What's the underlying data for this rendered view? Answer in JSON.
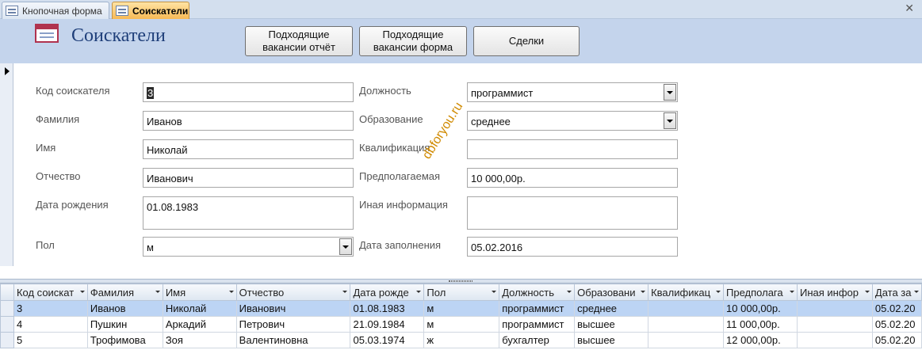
{
  "tabs": [
    {
      "label": "Кнопочная форма",
      "active": false
    },
    {
      "label": "Соискатели",
      "active": true
    }
  ],
  "form": {
    "title": "Соискатели",
    "buttons": {
      "report": "Подходящие\nвакансии отчёт",
      "form": "Подходящие\nвакансии форма",
      "deals": "Сделки"
    }
  },
  "fields": {
    "id": {
      "label": "Код соискателя",
      "value": "3"
    },
    "surname": {
      "label": "Фамилия",
      "value": "Иванов"
    },
    "name": {
      "label": "Имя",
      "value": "Николай"
    },
    "patronymic": {
      "label": "Отчество",
      "value": "Иванович"
    },
    "birth": {
      "label": "Дата рождения",
      "value": "01.08.1983"
    },
    "gender": {
      "label": "Пол",
      "value": "м"
    },
    "position": {
      "label": "Должность",
      "value": "программист"
    },
    "education": {
      "label": "Образование",
      "value": "среднее"
    },
    "qualification": {
      "label": "Квалификация",
      "value": ""
    },
    "salary": {
      "label": "Предполагаемая",
      "value": "10 000,00р."
    },
    "other": {
      "label": "Иная  информация",
      "value": ""
    },
    "filled": {
      "label": "Дата заполнения",
      "value": "05.02.2016"
    }
  },
  "watermark": "dbforyou.ru",
  "grid": {
    "columns": [
      "Код соискат",
      "Фамилия",
      "Имя",
      "Отчество",
      "Дата рожде",
      "Пол",
      "Должность",
      "Образовани",
      "Квалификац",
      "Предполага",
      "Иная  инфор",
      "Дата за"
    ],
    "rows": [
      [
        "3",
        "Иванов",
        "Николай",
        "Иванович",
        "01.08.1983",
        "м",
        "программист",
        "среднее",
        "",
        "10 000,00р.",
        "",
        "05.02.20"
      ],
      [
        "4",
        "Пушкин",
        "Аркадий",
        "Петрович",
        "21.09.1984",
        "м",
        "программист",
        "высшее",
        "",
        "11 000,00р.",
        "",
        "05.02.20"
      ],
      [
        "5",
        "Трофимова",
        "Зоя",
        "Валентиновна",
        "05.03.1974",
        "ж",
        "бухгалтер",
        "высшее",
        "",
        "12 000,00р.",
        "",
        "05.02.20"
      ]
    ],
    "current_row": 0
  }
}
